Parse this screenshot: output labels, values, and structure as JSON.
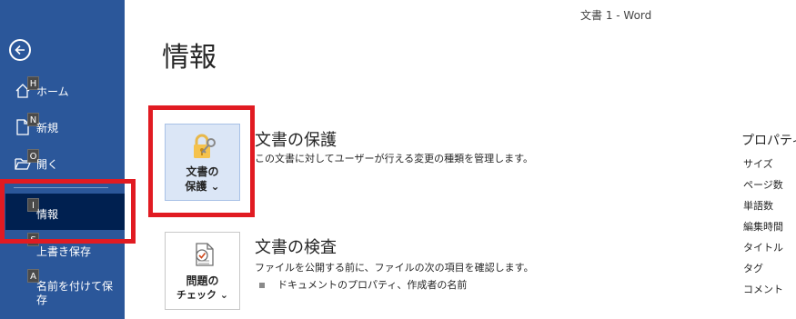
{
  "window": {
    "doc_title": "文書 1  -  Word"
  },
  "sidebar": {
    "items": [
      {
        "label": "ホーム",
        "keytip": "H"
      },
      {
        "label": "新規",
        "keytip": "N"
      },
      {
        "label": "開く",
        "keytip": "O"
      },
      {
        "label": "情報",
        "keytip": "I"
      },
      {
        "label": "上書き保存",
        "keytip": "S"
      },
      {
        "label": "名前を付けて保\n存",
        "keytip": "A"
      }
    ]
  },
  "main": {
    "page_title": "情報",
    "protect": {
      "button_line1": "文書の",
      "button_line2": "保護 ⌄",
      "title": "文書の保護",
      "description": "この文書に対してユーザーが行える変更の種類を管理します。"
    },
    "inspect": {
      "button_line1": "問題の",
      "button_line2": "チェック ⌄",
      "title": "文書の検査",
      "description": "ファイルを公開する前に、ファイルの次の項目を確認します。",
      "bullet": "ドキュメントのプロパティ、作成者の名前"
    }
  },
  "properties": {
    "header": "プロパティ",
    "labels": [
      "サイズ",
      "ページ数",
      "単語数",
      "編集時間",
      "タイトル",
      "タグ",
      "コメント"
    ]
  },
  "colors": {
    "sidebar": "#2b579a",
    "selected_nav": "#002050",
    "annotation": "#e11b22"
  }
}
